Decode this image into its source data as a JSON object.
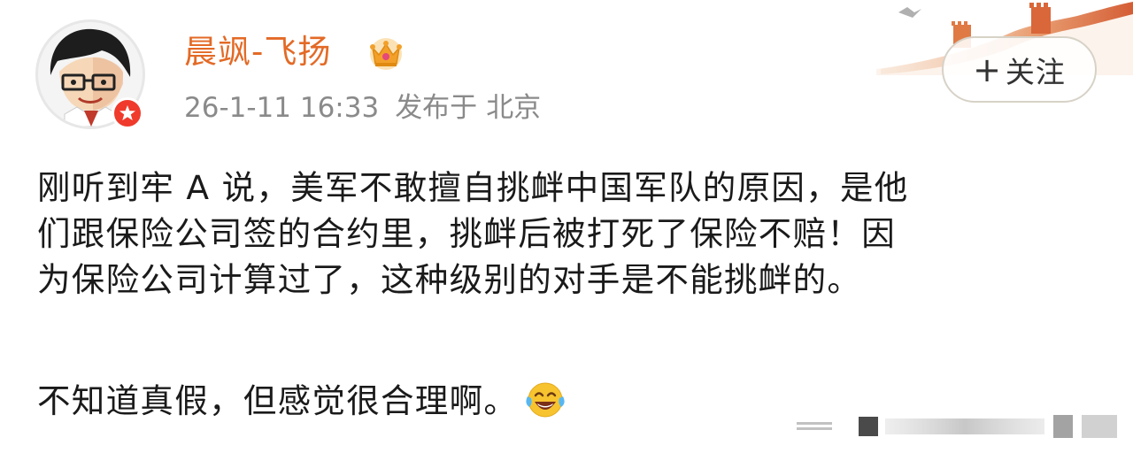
{
  "user": {
    "name": "晨飒-飞扬",
    "avatar_icon": "cartoon-avatar-glasses",
    "verified_icon": "red-verified-badge-icon",
    "member_icon": "crown-icon",
    "name_color": "#e36a26"
  },
  "meta": {
    "timestamp": "26-1-11 16:33",
    "published_at_label": "发布于",
    "location": "北京"
  },
  "actions": {
    "follow_label": "关注",
    "follow_icon": "plus-icon"
  },
  "post": {
    "paragraph1_lines": [
      "刚听到牢 A 说，美军不敢擅自挑衅中国军队的原因，是他",
      "们跟保险公司签的合约里，挑衅后被打死了保险不赔！因",
      "为保险公司计算过了，这种级别的对手是不能挑衅的。"
    ],
    "paragraph2": "不知道真假，但感觉很合理啊。",
    "paragraph2_emoji": "laughing-tears-emoji"
  }
}
